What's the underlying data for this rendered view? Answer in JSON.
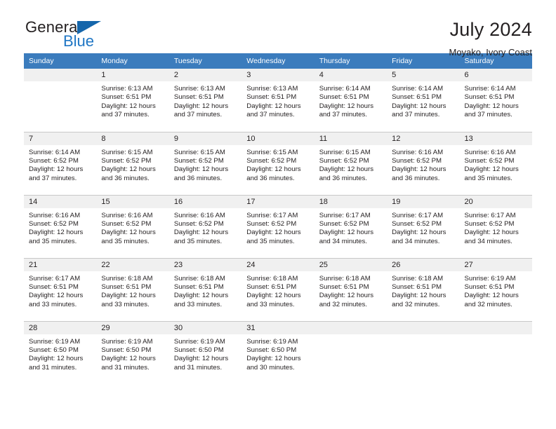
{
  "brand": {
    "name_top": "General",
    "name_bottom": "Blue",
    "accent_color": "#1f76c4",
    "triangle_color": "#1566ab"
  },
  "header": {
    "title": "July 2024",
    "subtitle": "Moyako, Ivory Coast"
  },
  "calendar": {
    "header_background": "#3b7cbd",
    "daynum_background": "#f0f0f0",
    "weekday_headers": [
      "Sunday",
      "Monday",
      "Tuesday",
      "Wednesday",
      "Thursday",
      "Friday",
      "Saturday"
    ],
    "weeks": [
      [
        {
          "day": "",
          "sunrise": "",
          "sunset": "",
          "daylight_line1": "",
          "daylight_line2": "",
          "empty": true
        },
        {
          "day": "1",
          "sunrise": "Sunrise: 6:13 AM",
          "sunset": "Sunset: 6:51 PM",
          "daylight_line1": "Daylight: 12 hours",
          "daylight_line2": "and 37 minutes."
        },
        {
          "day": "2",
          "sunrise": "Sunrise: 6:13 AM",
          "sunset": "Sunset: 6:51 PM",
          "daylight_line1": "Daylight: 12 hours",
          "daylight_line2": "and 37 minutes."
        },
        {
          "day": "3",
          "sunrise": "Sunrise: 6:13 AM",
          "sunset": "Sunset: 6:51 PM",
          "daylight_line1": "Daylight: 12 hours",
          "daylight_line2": "and 37 minutes."
        },
        {
          "day": "4",
          "sunrise": "Sunrise: 6:14 AM",
          "sunset": "Sunset: 6:51 PM",
          "daylight_line1": "Daylight: 12 hours",
          "daylight_line2": "and 37 minutes."
        },
        {
          "day": "5",
          "sunrise": "Sunrise: 6:14 AM",
          "sunset": "Sunset: 6:51 PM",
          "daylight_line1": "Daylight: 12 hours",
          "daylight_line2": "and 37 minutes."
        },
        {
          "day": "6",
          "sunrise": "Sunrise: 6:14 AM",
          "sunset": "Sunset: 6:51 PM",
          "daylight_line1": "Daylight: 12 hours",
          "daylight_line2": "and 37 minutes."
        }
      ],
      [
        {
          "day": "7",
          "sunrise": "Sunrise: 6:14 AM",
          "sunset": "Sunset: 6:52 PM",
          "daylight_line1": "Daylight: 12 hours",
          "daylight_line2": "and 37 minutes."
        },
        {
          "day": "8",
          "sunrise": "Sunrise: 6:15 AM",
          "sunset": "Sunset: 6:52 PM",
          "daylight_line1": "Daylight: 12 hours",
          "daylight_line2": "and 36 minutes."
        },
        {
          "day": "9",
          "sunrise": "Sunrise: 6:15 AM",
          "sunset": "Sunset: 6:52 PM",
          "daylight_line1": "Daylight: 12 hours",
          "daylight_line2": "and 36 minutes."
        },
        {
          "day": "10",
          "sunrise": "Sunrise: 6:15 AM",
          "sunset": "Sunset: 6:52 PM",
          "daylight_line1": "Daylight: 12 hours",
          "daylight_line2": "and 36 minutes."
        },
        {
          "day": "11",
          "sunrise": "Sunrise: 6:15 AM",
          "sunset": "Sunset: 6:52 PM",
          "daylight_line1": "Daylight: 12 hours",
          "daylight_line2": "and 36 minutes."
        },
        {
          "day": "12",
          "sunrise": "Sunrise: 6:16 AM",
          "sunset": "Sunset: 6:52 PM",
          "daylight_line1": "Daylight: 12 hours",
          "daylight_line2": "and 36 minutes."
        },
        {
          "day": "13",
          "sunrise": "Sunrise: 6:16 AM",
          "sunset": "Sunset: 6:52 PM",
          "daylight_line1": "Daylight: 12 hours",
          "daylight_line2": "and 35 minutes."
        }
      ],
      [
        {
          "day": "14",
          "sunrise": "Sunrise: 6:16 AM",
          "sunset": "Sunset: 6:52 PM",
          "daylight_line1": "Daylight: 12 hours",
          "daylight_line2": "and 35 minutes."
        },
        {
          "day": "15",
          "sunrise": "Sunrise: 6:16 AM",
          "sunset": "Sunset: 6:52 PM",
          "daylight_line1": "Daylight: 12 hours",
          "daylight_line2": "and 35 minutes."
        },
        {
          "day": "16",
          "sunrise": "Sunrise: 6:16 AM",
          "sunset": "Sunset: 6:52 PM",
          "daylight_line1": "Daylight: 12 hours",
          "daylight_line2": "and 35 minutes."
        },
        {
          "day": "17",
          "sunrise": "Sunrise: 6:17 AM",
          "sunset": "Sunset: 6:52 PM",
          "daylight_line1": "Daylight: 12 hours",
          "daylight_line2": "and 35 minutes."
        },
        {
          "day": "18",
          "sunrise": "Sunrise: 6:17 AM",
          "sunset": "Sunset: 6:52 PM",
          "daylight_line1": "Daylight: 12 hours",
          "daylight_line2": "and 34 minutes."
        },
        {
          "day": "19",
          "sunrise": "Sunrise: 6:17 AM",
          "sunset": "Sunset: 6:52 PM",
          "daylight_line1": "Daylight: 12 hours",
          "daylight_line2": "and 34 minutes."
        },
        {
          "day": "20",
          "sunrise": "Sunrise: 6:17 AM",
          "sunset": "Sunset: 6:52 PM",
          "daylight_line1": "Daylight: 12 hours",
          "daylight_line2": "and 34 minutes."
        }
      ],
      [
        {
          "day": "21",
          "sunrise": "Sunrise: 6:17 AM",
          "sunset": "Sunset: 6:51 PM",
          "daylight_line1": "Daylight: 12 hours",
          "daylight_line2": "and 33 minutes."
        },
        {
          "day": "22",
          "sunrise": "Sunrise: 6:18 AM",
          "sunset": "Sunset: 6:51 PM",
          "daylight_line1": "Daylight: 12 hours",
          "daylight_line2": "and 33 minutes."
        },
        {
          "day": "23",
          "sunrise": "Sunrise: 6:18 AM",
          "sunset": "Sunset: 6:51 PM",
          "daylight_line1": "Daylight: 12 hours",
          "daylight_line2": "and 33 minutes."
        },
        {
          "day": "24",
          "sunrise": "Sunrise: 6:18 AM",
          "sunset": "Sunset: 6:51 PM",
          "daylight_line1": "Daylight: 12 hours",
          "daylight_line2": "and 33 minutes."
        },
        {
          "day": "25",
          "sunrise": "Sunrise: 6:18 AM",
          "sunset": "Sunset: 6:51 PM",
          "daylight_line1": "Daylight: 12 hours",
          "daylight_line2": "and 32 minutes."
        },
        {
          "day": "26",
          "sunrise": "Sunrise: 6:18 AM",
          "sunset": "Sunset: 6:51 PM",
          "daylight_line1": "Daylight: 12 hours",
          "daylight_line2": "and 32 minutes."
        },
        {
          "day": "27",
          "sunrise": "Sunrise: 6:19 AM",
          "sunset": "Sunset: 6:51 PM",
          "daylight_line1": "Daylight: 12 hours",
          "daylight_line2": "and 32 minutes."
        }
      ],
      [
        {
          "day": "28",
          "sunrise": "Sunrise: 6:19 AM",
          "sunset": "Sunset: 6:50 PM",
          "daylight_line1": "Daylight: 12 hours",
          "daylight_line2": "and 31 minutes."
        },
        {
          "day": "29",
          "sunrise": "Sunrise: 6:19 AM",
          "sunset": "Sunset: 6:50 PM",
          "daylight_line1": "Daylight: 12 hours",
          "daylight_line2": "and 31 minutes."
        },
        {
          "day": "30",
          "sunrise": "Sunrise: 6:19 AM",
          "sunset": "Sunset: 6:50 PM",
          "daylight_line1": "Daylight: 12 hours",
          "daylight_line2": "and 31 minutes."
        },
        {
          "day": "31",
          "sunrise": "Sunrise: 6:19 AM",
          "sunset": "Sunset: 6:50 PM",
          "daylight_line1": "Daylight: 12 hours",
          "daylight_line2": "and 30 minutes."
        },
        {
          "day": "",
          "sunrise": "",
          "sunset": "",
          "daylight_line1": "",
          "daylight_line2": "",
          "empty": true
        },
        {
          "day": "",
          "sunrise": "",
          "sunset": "",
          "daylight_line1": "",
          "daylight_line2": "",
          "empty": true
        },
        {
          "day": "",
          "sunrise": "",
          "sunset": "",
          "daylight_line1": "",
          "daylight_line2": "",
          "empty": true
        }
      ]
    ]
  }
}
